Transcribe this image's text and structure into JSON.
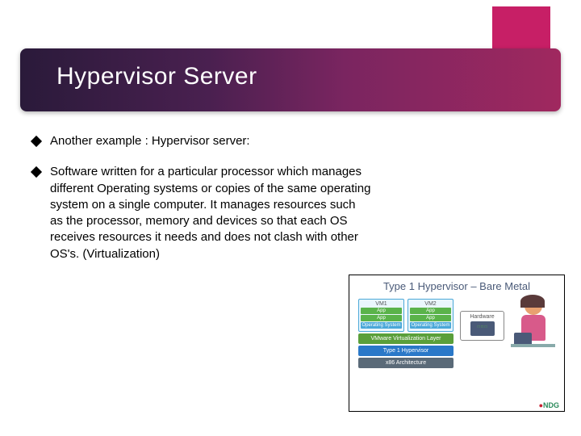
{
  "slide": {
    "title": "Hypervisor Server",
    "bullets": [
      "Another example : Hypervisor server:",
      "Software written for a particular processor which manages different Operating systems or copies of the same operating system on a single computer. It manages resources such as the processor, memory and devices so that each OS receives resources it needs and does not clash with other OS's.\n(Virtualization)"
    ]
  },
  "diagram": {
    "title": "Type 1 Hypervisor – Bare Metal",
    "vm1_label": "VM1",
    "vm2_label": "VM2",
    "app_label": "App",
    "os_label": "Operating System",
    "vmware_layer": "VMware Virtualization Layer",
    "hypervisor_layer": "Type 1 Hypervisor",
    "hardware_layer": "x86 Architecture",
    "hardware_box": "Hardware",
    "brand": "NDG"
  }
}
